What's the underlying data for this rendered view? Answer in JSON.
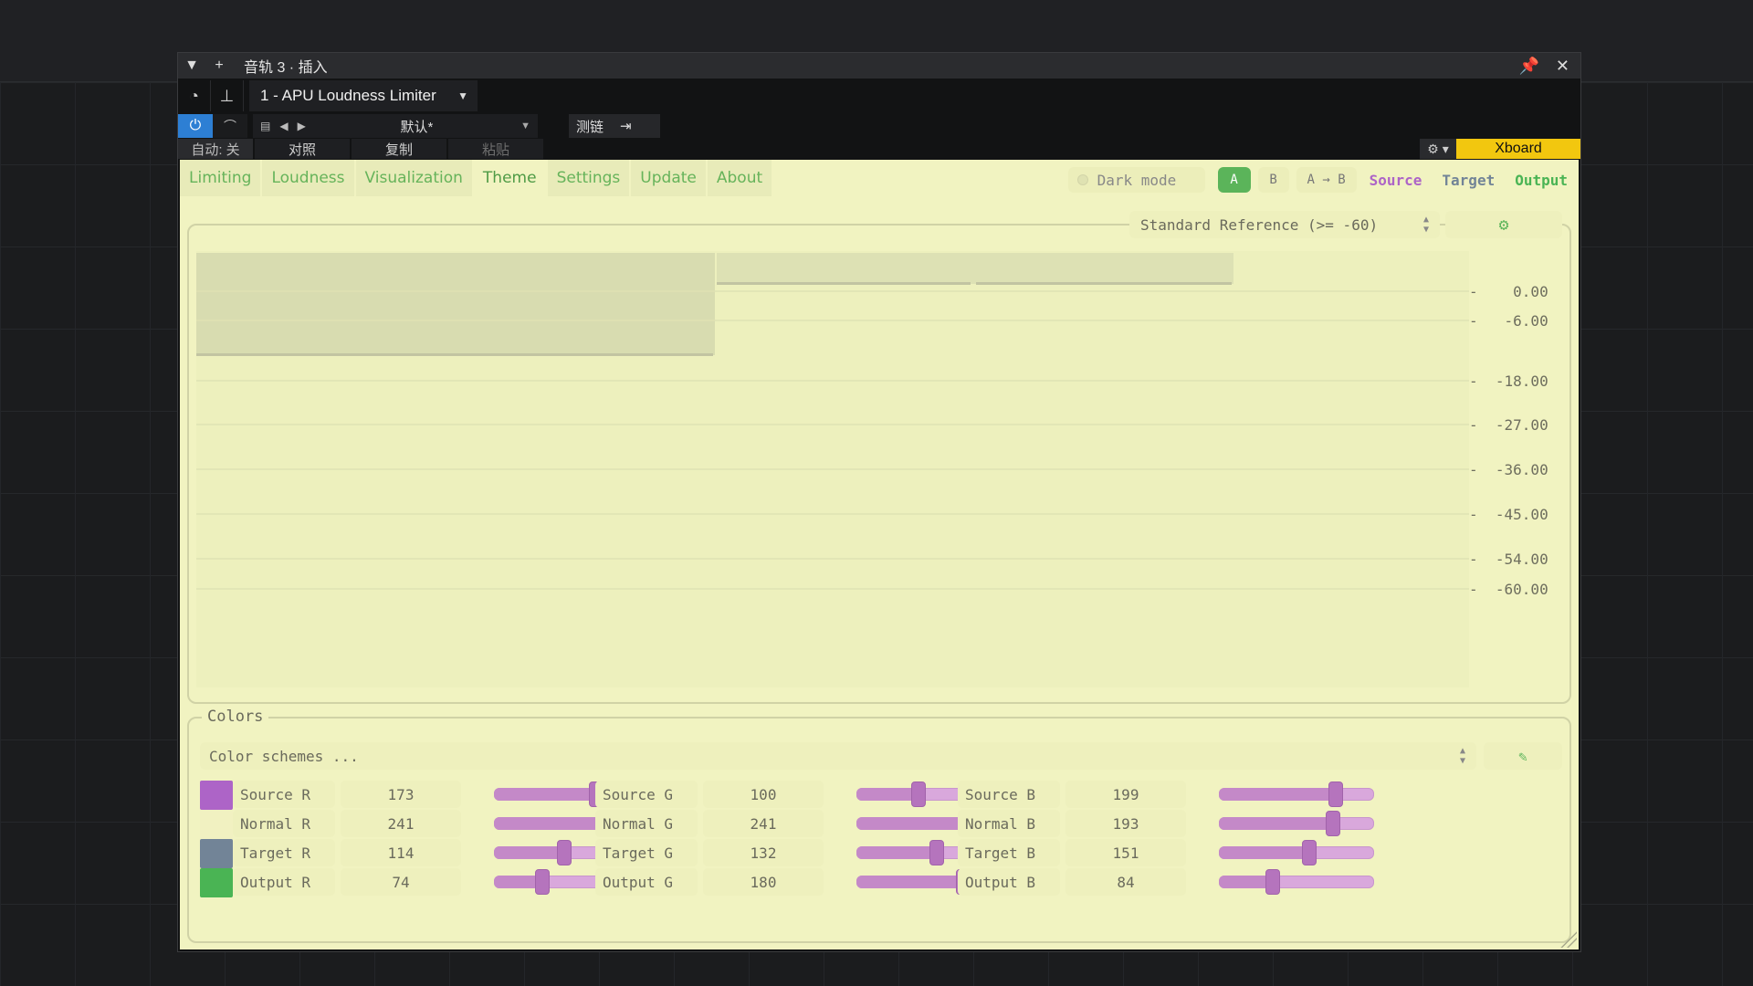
{
  "host": {
    "title": "音轨 3 · 插入",
    "plugin_name": "1 - APU Loudness Limiter",
    "preset_name": "默认*",
    "chain_label": "测链",
    "auto_label": "自动: 关",
    "compare_label": "对照",
    "copy_label": "复制",
    "paste_label": "粘贴",
    "xboard_label": "Xboard"
  },
  "tabs": [
    "Limiting",
    "Loudness",
    "Visualization",
    "Theme",
    "Settings",
    "Update",
    "About"
  ],
  "active_tab": "Theme",
  "controls": {
    "dark_mode_label": "Dark mode",
    "a_label": "A",
    "b_label": "B",
    "a_to_b_label": "A → B",
    "legend_source": "Source",
    "legend_target": "Target",
    "legend_output": "Output",
    "reference_select": "Standard Reference (>= -60)"
  },
  "colors_theme": {
    "source": "#ad64c7",
    "target": "#728497",
    "output": "#4ab454",
    "normal": "#f1f1c1",
    "accent_green": "#5bb45a"
  },
  "chart": {
    "y_ticks": [
      "0.00",
      "-6.00",
      "-18.00",
      "-27.00",
      "-36.00",
      "-45.00",
      "-54.00",
      "-60.00"
    ],
    "y_values": [
      0,
      -6,
      -18,
      -27,
      -36,
      -45,
      -54,
      -60
    ]
  },
  "colors_panel": {
    "title": "Colors",
    "scheme_placeholder": "Color schemes ...",
    "rows": [
      {
        "name": "source",
        "swatch": "#ad64c7",
        "r": {
          "label": "Source R",
          "value": "173"
        },
        "g": {
          "label": "Source G",
          "value": "100"
        },
        "b": {
          "label": "Source B",
          "value": "199"
        }
      },
      {
        "name": "normal",
        "swatch": "#f1f1c1",
        "r": {
          "label": "Normal R",
          "value": "241"
        },
        "g": {
          "label": "Normal G",
          "value": "241"
        },
        "b": {
          "label": "Normal B",
          "value": "193"
        }
      },
      {
        "name": "target",
        "swatch": "#728497",
        "r": {
          "label": "Target R",
          "value": "114"
        },
        "g": {
          "label": "Target G",
          "value": "132"
        },
        "b": {
          "label": "Target B",
          "value": "151"
        }
      },
      {
        "name": "output",
        "swatch": "#4ab454",
        "r": {
          "label": "Output R",
          "value": "74"
        },
        "g": {
          "label": "Output G",
          "value": "180"
        },
        "b": {
          "label": "Output B",
          "value": "84"
        }
      }
    ]
  }
}
